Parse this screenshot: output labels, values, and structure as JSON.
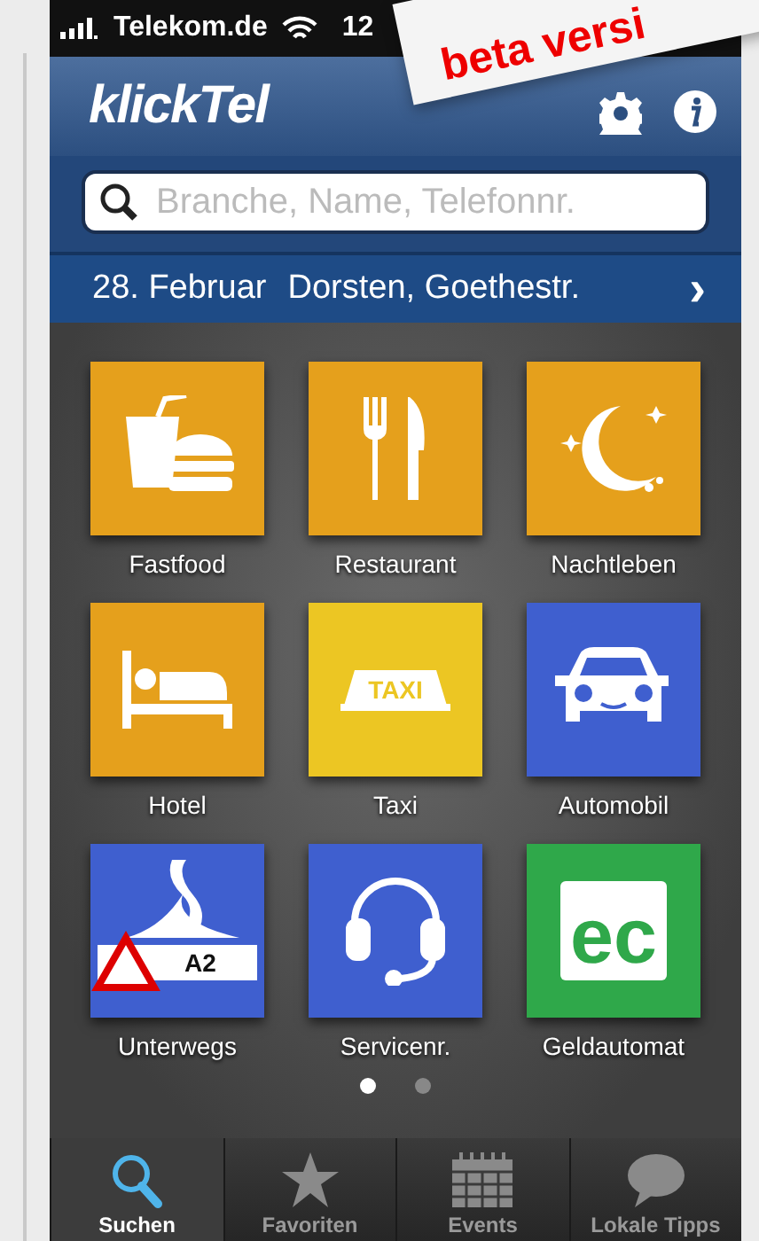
{
  "status_bar": {
    "carrier": "Telekom.de",
    "time": "12"
  },
  "header": {
    "logo": "klickTel"
  },
  "sticker": {
    "text": "beta versi"
  },
  "search": {
    "placeholder": "Branche, Name, Telefonnr."
  },
  "location_bar": {
    "date": "28. Februar",
    "place": "Dorsten, Goethestr.",
    "chevron": "›"
  },
  "tiles": [
    {
      "label": "Fastfood",
      "color": "#e5a01c",
      "kind": "fastfood"
    },
    {
      "label": "Restaurant",
      "color": "#e5a01c",
      "kind": "restaurant"
    },
    {
      "label": "Nachtleben",
      "color": "#e5a01c",
      "kind": "nightlife"
    },
    {
      "label": "Hotel",
      "color": "#e5a01c",
      "kind": "hotel"
    },
    {
      "label": "Taxi",
      "color": "#ecc623",
      "kind": "taxi",
      "sign": "TAXI"
    },
    {
      "label": "Automobil",
      "color": "#3f5fcf",
      "kind": "car"
    },
    {
      "label": "Unterwegs",
      "color": "#3f5fcf",
      "kind": "road",
      "sign": "A2"
    },
    {
      "label": "Servicenr.",
      "color": "#3f5fcf",
      "kind": "headset"
    },
    {
      "label": "Geldautomat",
      "color": "#2fa84a",
      "kind": "ec",
      "sign": "ec"
    }
  ],
  "page_dots": [
    {
      "selected": true
    },
    {
      "selected": false
    }
  ],
  "tabs": [
    {
      "label": "Suchen",
      "kind": "search",
      "selected": true
    },
    {
      "label": "Favoriten",
      "kind": "star",
      "selected": false
    },
    {
      "label": "Events",
      "kind": "calendar",
      "selected": false
    },
    {
      "label": "Lokale Tipps",
      "kind": "chat",
      "selected": false
    }
  ]
}
